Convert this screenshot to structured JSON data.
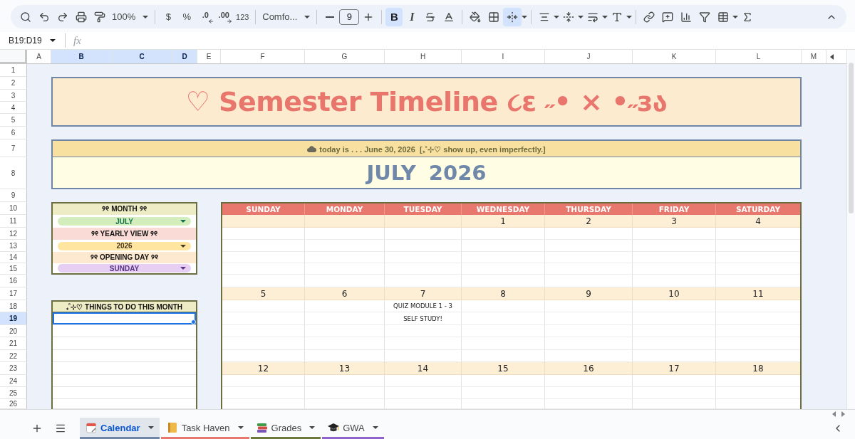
{
  "toolbar": {
    "zoom": "100%",
    "currency": "$",
    "percent": "%",
    "decrease_decimal": ".0",
    "increase_decimal": ".00",
    "number_format": "123",
    "font": "Comfo...",
    "font_size": "9",
    "bold": {
      "label": "B",
      "on": true
    },
    "italic": {
      "label": "I",
      "on": false
    },
    "merge_cells": {
      "on": true
    }
  },
  "formula_bar": {
    "name_box": "B19:D19",
    "fx": "fx"
  },
  "columns": [
    {
      "label": "A",
      "selected": false
    },
    {
      "label": "B",
      "selected": true
    },
    {
      "label": "C",
      "selected": true
    },
    {
      "label": "D",
      "selected": true
    },
    {
      "label": "E",
      "selected": false
    },
    {
      "label": "F",
      "selected": false
    },
    {
      "label": "G",
      "selected": false
    },
    {
      "label": "H",
      "selected": false
    },
    {
      "label": "I",
      "selected": false
    },
    {
      "label": "J",
      "selected": false
    },
    {
      "label": "K",
      "selected": false
    },
    {
      "label": "L",
      "selected": false
    },
    {
      "label": "M",
      "selected": false
    }
  ],
  "rows": [
    {
      "label": "1",
      "selected": false
    },
    {
      "label": "2",
      "selected": false
    },
    {
      "label": "3",
      "selected": false
    },
    {
      "label": "4",
      "selected": false
    },
    {
      "label": "5",
      "selected": false
    },
    {
      "label": "6",
      "selected": false
    },
    {
      "label": "7",
      "selected": false
    },
    {
      "label": "8",
      "selected": false
    },
    {
      "label": "9",
      "selected": false
    },
    {
      "label": "10",
      "selected": false
    },
    {
      "label": "11",
      "selected": false
    },
    {
      "label": "12",
      "selected": false
    },
    {
      "label": "13",
      "selected": false
    },
    {
      "label": "14",
      "selected": false
    },
    {
      "label": "15",
      "selected": false
    },
    {
      "label": "16",
      "selected": false
    },
    {
      "label": "17",
      "selected": false
    },
    {
      "label": "18",
      "selected": false
    },
    {
      "label": "19",
      "selected": true
    },
    {
      "label": "20",
      "selected": false
    },
    {
      "label": "21",
      "selected": false
    },
    {
      "label": "22",
      "selected": false
    },
    {
      "label": "23",
      "selected": false
    },
    {
      "label": "24",
      "selected": false
    },
    {
      "label": "25",
      "selected": false
    },
    {
      "label": "26",
      "selected": false
    }
  ],
  "banner": {
    "title": "♡ Semester Timeline ૮ɛ ˶• × •˶зა"
  },
  "today": {
    "text": "today is . . . June 30, 2026  [₊˚⊹♡ show up, even imperfectly.]"
  },
  "month_heading": "JULY 2026",
  "settings": [
    {
      "label": "୨୧ MONTH ୨୧",
      "value": "JULY",
      "color": "#d4edbc"
    },
    {
      "label": "୨୧ YEARLY VIEW ୨୧",
      "value": "2026",
      "color": "#ffe5a0"
    },
    {
      "label": "୨୧ OPENING DAY ୨୧",
      "value": "SUNDAY",
      "color": "#e6cff2"
    }
  ],
  "todo": {
    "title": "₊˚⊹♡ THINGS TO DO THIS MONTH",
    "lines": [
      {
        "selected": true
      },
      {
        "selected": false
      },
      {
        "selected": false
      },
      {
        "selected": false
      },
      {
        "selected": false
      },
      {
        "selected": false
      },
      {
        "selected": false
      },
      {
        "selected": false
      }
    ]
  },
  "calendar": {
    "weekdays": [
      "SUNDAY",
      "MONDAY",
      "TUESDAY",
      "WEDNESDAY",
      "THURSDAY",
      "FRIDAY",
      "SATURDAY"
    ],
    "weeks": [
      {
        "days": [
          {
            "date": "1"
          },
          {
            "date": "2"
          },
          {
            "date": "3"
          },
          {
            "date": "4"
          }
        ]
      },
      {
        "days": [
          {
            "date": "5"
          },
          {
            "date": "6"
          },
          {
            "date": "7",
            "events": [
              "QUIZ MODULE 1 - 3",
              "SELF STUDY!"
            ]
          },
          {
            "date": "8"
          },
          {
            "date": "9"
          },
          {
            "date": "10"
          },
          {
            "date": "11"
          }
        ]
      },
      {
        "days": [
          {
            "date": "12"
          },
          {
            "date": "13"
          },
          {
            "date": "14"
          },
          {
            "date": "15"
          },
          {
            "date": "16"
          },
          {
            "date": "17"
          },
          {
            "date": "18"
          }
        ]
      }
    ]
  },
  "sheet_tabs": [
    {
      "label": "Calendar",
      "selected": true,
      "color": "#6f86a6"
    },
    {
      "label": "Task Haven",
      "selected": false,
      "color": "#e8776e"
    },
    {
      "label": "Grades",
      "selected": false,
      "color": "#6b7a3a"
    },
    {
      "label": "GWA",
      "selected": false,
      "color": "#8e63ce"
    }
  ]
}
